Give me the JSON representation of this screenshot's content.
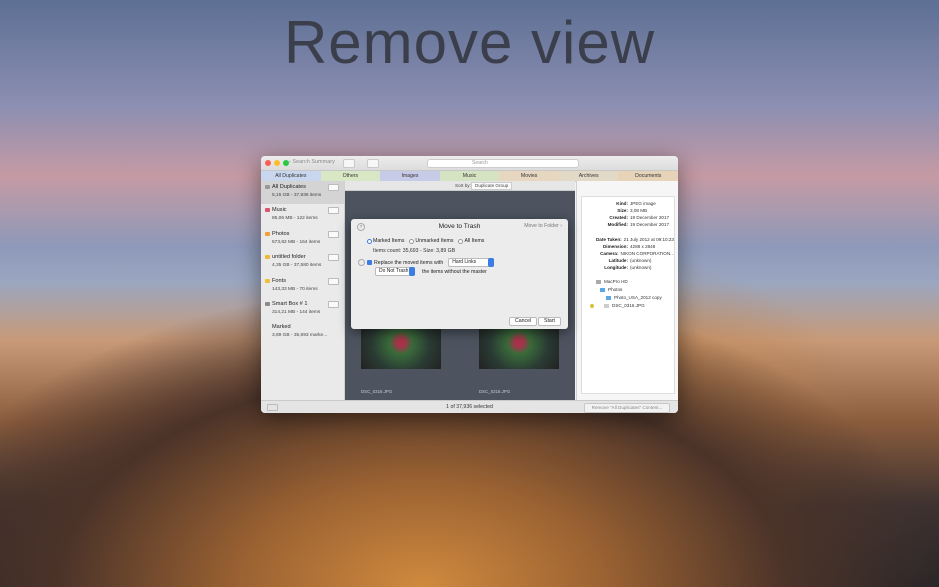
{
  "hero_title": "Remove view",
  "window": {
    "search_summary": "Search Summary",
    "search_placeholder": "Search",
    "tabs": [
      {
        "label": "All Duplicates",
        "color": "#c9d7ee"
      },
      {
        "label": "Others",
        "color": "#d9e7c5"
      },
      {
        "label": "Images",
        "color": "#c8cbe8"
      },
      {
        "label": "Music",
        "color": "#d6e3c2"
      },
      {
        "label": "Movies",
        "color": "#e7d7c1"
      },
      {
        "label": "Archives",
        "color": "#e2d9c6"
      },
      {
        "label": "Documents",
        "color": "#e7d4b8"
      }
    ],
    "sidebar": [
      {
        "name": "All Duplicates",
        "size": "5,15 GB - 37,936 items",
        "icon": "duplicates-icon",
        "color": "#999999"
      },
      {
        "name": "Music",
        "size": "85,06 MB - 122 items",
        "icon": "folder-icon",
        "color": "#e0526e"
      },
      {
        "name": "Photos",
        "size": "573,82 MB - 164 items",
        "icon": "folder-icon",
        "color": "#f0a03a"
      },
      {
        "name": "untitled folder",
        "size": "4,35 GB - 37,580 items",
        "icon": "folder-icon",
        "color": "#f0b83a"
      },
      {
        "name": "Fonts",
        "size": "143,33 MB - 70 items",
        "icon": "folder-icon",
        "color": "#f0c03a"
      },
      {
        "name": "Smart Box # 1",
        "size": "314,21 MB - 144 items",
        "icon": "smart-box-icon",
        "color": "#8b8b8b"
      },
      {
        "name": "Marked",
        "size": "3,89 GB - 35,693 marke...",
        "icon": "",
        "color": ""
      }
    ],
    "content_bar": {
      "sort_label": "Sort by:",
      "sort_value": "Duplicate Group"
    },
    "thumb_caption": "DSC_0316.JPG",
    "info": {
      "fields": [
        {
          "k": "Kind:",
          "v": "JPEG image"
        },
        {
          "k": "Size:",
          "v": "3,08 MB"
        },
        {
          "k": "Created:",
          "v": "19 December 2017"
        },
        {
          "k": "Modified:",
          "v": "19 December 2017"
        }
      ],
      "fields2": [
        {
          "k": "Date Taken:",
          "v": "21 July 2012 at 09:10:23"
        },
        {
          "k": "Dimension:",
          "v": "4288 x 2848"
        },
        {
          "k": "Camera:",
          "v": "NIKON CORPORATION..."
        },
        {
          "k": "Latitude:",
          "v": "(unknown)"
        },
        {
          "k": "Longitude:",
          "v": "(unknown)"
        }
      ],
      "path": [
        "MacPro HD",
        "Photos",
        "Photo_USA_2012 copy",
        "DSC_0316.JPG"
      ]
    },
    "footer": {
      "status": "1 of 37,936 selected",
      "remove_button": "Remove \"All Duplicates\" Content..."
    }
  },
  "dialog": {
    "title": "Move to Trash",
    "move_to_folder": "Move to Folder",
    "radios": [
      "Marked Items",
      "Unmarked Items",
      "All Items"
    ],
    "count": "Items count: 35,693 - Size: 3,89 GB",
    "replace_label": "Replace the moved items with",
    "link_type": "Hard Links",
    "do_not_trash": "Do Not Trash",
    "without_master": "the items without the master",
    "cancel": "Cancel",
    "start": "Start"
  }
}
